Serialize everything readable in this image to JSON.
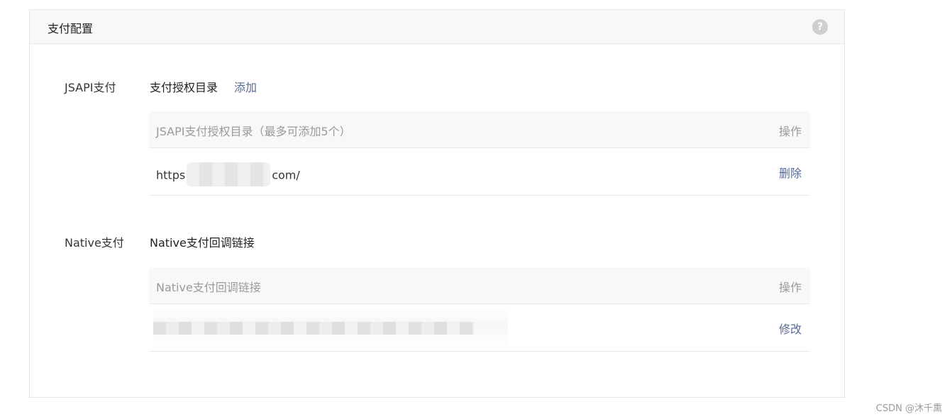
{
  "panel": {
    "title": "支付配置",
    "help_icon": "question-circle-icon",
    "help_glyph": "?"
  },
  "jsapi": {
    "row_label": "JSAPI支付",
    "section_title": "支付授权目录",
    "add_label": "添加",
    "table": {
      "header_left": "JSAPI支付授权目录（最多可添加5个）",
      "header_right": "操作",
      "rows": [
        {
          "prefix": "https",
          "suffix": "com/",
          "action": "删除"
        }
      ]
    }
  },
  "native": {
    "row_label": "Native支付",
    "section_title": "Native支付回调链接",
    "table": {
      "header_left": "Native支付回调链接",
      "header_right": "操作",
      "rows": [
        {
          "action": "修改"
        }
      ]
    }
  },
  "watermark": "CSDN @沐千熏",
  "colors": {
    "link": "#576b95",
    "header_bg": "#f8f8f8",
    "border": "#e7e7eb"
  }
}
